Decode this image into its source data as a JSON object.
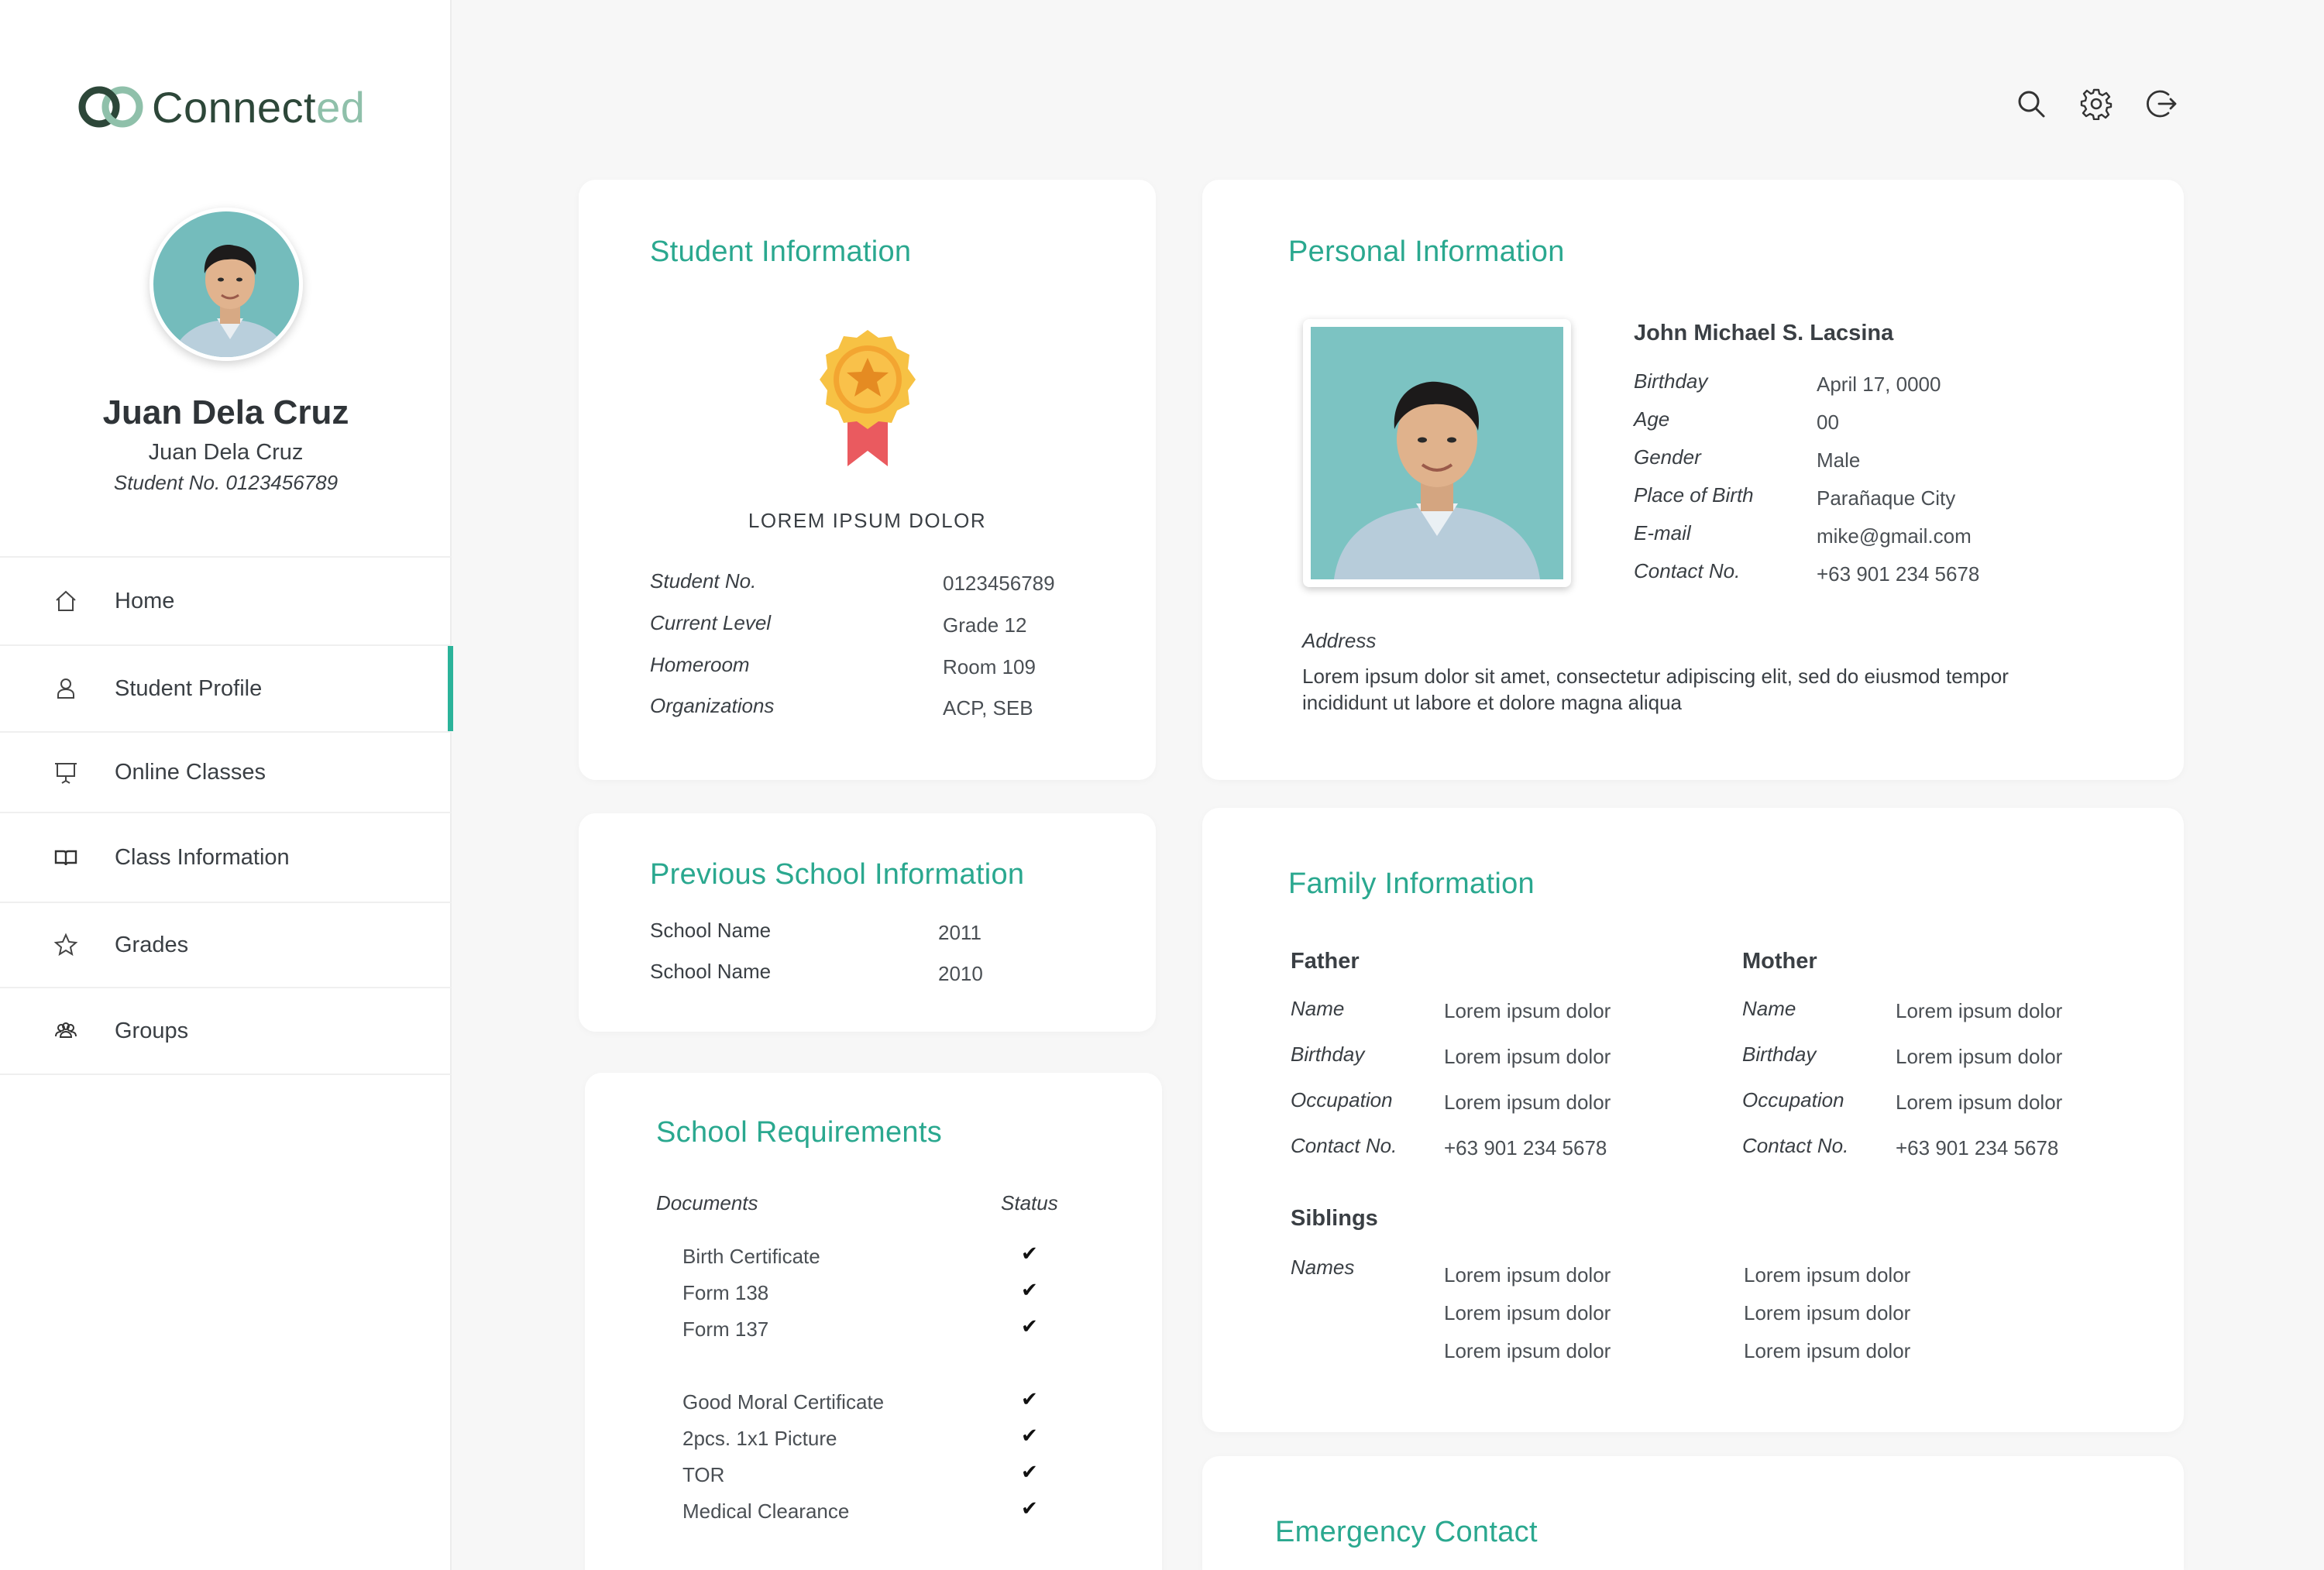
{
  "app": {
    "logo_dark": "Connect",
    "logo_light": "ed",
    "accent_color": "#2bb39a"
  },
  "profile": {
    "name": "Juan Dela Cruz",
    "subname": "Juan Dela Cruz",
    "student_no": "Student No. 0123456789"
  },
  "nav": [
    {
      "label": "Home",
      "icon": "home-icon"
    },
    {
      "label": "Student Profile",
      "icon": "user-icon",
      "active": true
    },
    {
      "label": "Online Classes",
      "icon": "presentation-board-icon"
    },
    {
      "label": "Class Information",
      "icon": "book-icon"
    },
    {
      "label": "Grades",
      "icon": "star-icon"
    },
    {
      "label": "Groups",
      "icon": "group-icon"
    }
  ],
  "top_icons": [
    "search-icon",
    "settings-gear-icon",
    "logout-icon"
  ],
  "student_info": {
    "title": "Student Information",
    "badge_caption": "LOREM IPSUM DOLOR",
    "rows": [
      {
        "label": "Student No.",
        "value": "0123456789"
      },
      {
        "label": "Current Level",
        "value": "Grade 12"
      },
      {
        "label": "Homeroom",
        "value": "Room 109"
      },
      {
        "label": "Organizations",
        "value": "ACP, SEB"
      }
    ]
  },
  "previous_school": {
    "title": "Previous School Information",
    "rows": [
      {
        "label": "School Name",
        "value": "2011"
      },
      {
        "label": "School Name",
        "value": "2010"
      }
    ]
  },
  "requirements": {
    "title": "School Requirements",
    "col_documents": "Documents",
    "col_status": "Status",
    "group1": [
      "Birth Certificate",
      "Form 138",
      "Form 137"
    ],
    "group2": [
      "Good Moral Certificate",
      "2pcs. 1x1 Picture",
      "TOR",
      "Medical Clearance"
    ],
    "check_glyph": "✔"
  },
  "personal_info": {
    "title": "Personal Information",
    "full_name": "John Michael S. Lacsina",
    "rows": [
      {
        "label": "Birthday",
        "value": "April 17, 0000"
      },
      {
        "label": "Age",
        "value": "00"
      },
      {
        "label": "Gender",
        "value": "Male"
      },
      {
        "label": "Place of Birth",
        "value": "Parañaque City"
      },
      {
        "label": "E-mail",
        "value": "mike@gmail.com"
      },
      {
        "label": "Contact No.",
        "value": "+63 901 234 5678"
      }
    ],
    "address_label": "Address",
    "address_line1": "Lorem ipsum dolor sit amet, consectetur adipiscing elit, sed do eiusmod tempor",
    "address_line2": "incididunt ut labore et dolore magna aliqua"
  },
  "family_info": {
    "title": "Family Information",
    "father": {
      "heading": "Father",
      "rows": [
        {
          "label": "Name",
          "value": "Lorem ipsum dolor"
        },
        {
          "label": "Birthday",
          "value": "Lorem ipsum dolor"
        },
        {
          "label": "Occupation",
          "value": "Lorem ipsum dolor"
        },
        {
          "label": "Contact No.",
          "value": "+63 901 234 5678"
        }
      ]
    },
    "mother": {
      "heading": "Mother",
      "rows": [
        {
          "label": "Name",
          "value": "Lorem ipsum dolor"
        },
        {
          "label": "Birthday",
          "value": "Lorem ipsum dolor"
        },
        {
          "label": "Occupation",
          "value": "Lorem ipsum dolor"
        },
        {
          "label": "Contact No.",
          "value": "+63 901 234 5678"
        }
      ]
    },
    "siblings_heading": "Siblings",
    "siblings_label": "Names",
    "siblings_col1": [
      "Lorem ipsum dolor",
      "Lorem ipsum dolor",
      "Lorem ipsum dolor"
    ],
    "siblings_col2": [
      "Lorem ipsum dolor",
      "Lorem ipsum dolor",
      "Lorem ipsum dolor"
    ]
  },
  "emergency": {
    "title": "Emergency Contact"
  }
}
